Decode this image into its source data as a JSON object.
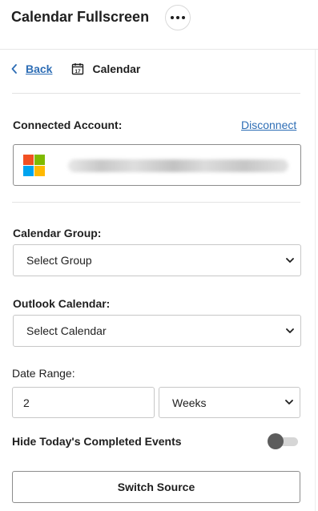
{
  "header": {
    "title": "Calendar Fullscreen",
    "more_icon": "more-horizontal-icon"
  },
  "breadcrumb": {
    "back_label": "Back",
    "back_icon": "chevron-left-icon",
    "current_icon": "calendar-icon",
    "current_label": "Calendar"
  },
  "account": {
    "label": "Connected Account:",
    "disconnect_label": "Disconnect",
    "provider_icon": "microsoft-logo-icon",
    "logo_colors": [
      "#f25022",
      "#7fba00",
      "#00a4ef",
      "#ffb900"
    ]
  },
  "calendar_group": {
    "label": "Calendar Group:",
    "selected": "Select Group"
  },
  "outlook_calendar": {
    "label": "Outlook Calendar:",
    "selected": "Select Calendar"
  },
  "date_range": {
    "label": "Date Range:",
    "value": "2",
    "unit_selected": "Weeks"
  },
  "hide_completed": {
    "label": "Hide Today's Completed Events",
    "enabled": false
  },
  "actions": {
    "switch_source_label": "Switch Source"
  },
  "colors": {
    "link": "#2d6db5",
    "toggle_knob": "#5c5c5c",
    "toggle_track": "#d6d6d6"
  }
}
